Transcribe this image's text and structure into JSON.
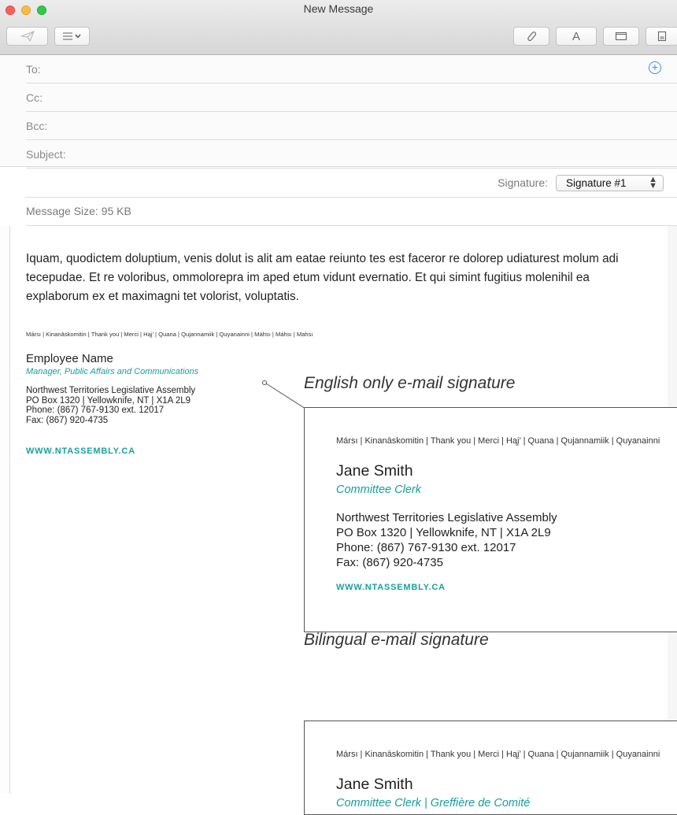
{
  "window": {
    "title": "New Message"
  },
  "toolbar": {
    "send_icon": "send-paper-plane-icon",
    "format_icon": "list-format-icon",
    "attach_icon": "paperclip-icon",
    "font_label": "A",
    "window_icon": "window-icon",
    "photo_browser_icon": "photo-browser-icon"
  },
  "fields": {
    "to_label": "To:",
    "cc_label": "Cc:",
    "bcc_label": "Bcc:",
    "subject_label": "Subject:",
    "signature_label": "Signature:",
    "signature_value": "Signature #1",
    "message_size": "Message Size: 95 KB"
  },
  "body": {
    "paragraph": "Iquam, quodictem doluptium, venis dolut is alit am eatae reiunto tes est faceror re dolorep udiaturest molum adi tecepudae. Et re voloribus, ommolorepra im aped etum vidunt evernatio. Et qui simint fugitius molenihil ea explaborum ex et maximagni tet volorist, voluptatis.",
    "thanks_line": "Mársı | Kinanāskomitin | Thank you | Merci | Hąį’ | Quana | Qujannamiik | Quyanainni | Máhsı | Máhsı | Mahsı",
    "signature": {
      "name": "Employee Name",
      "title": "Manager, Public Affairs and Communications",
      "org": "Northwest Territories Legislative Assembly",
      "address": "PO Box 1320  |  Yellowknife, NT  |  X1A 2L9",
      "phone": "Phone: (867) 767-9130 ext. 12017",
      "fax": "Fax: (867) 920-4735",
      "url": "WWW.NTASSEMBLY.CA"
    }
  },
  "examples": [
    {
      "caption": "English only e-mail signature",
      "thanks_line": "Mársı | Kinanāskomitin | Thank you | Merci | Hąį’ | Quana | Qujannamiik | Quyanainni",
      "name": "Jane Smith",
      "title": "Committee Clerk",
      "org": "Northwest Territories Legislative Assembly",
      "address": "PO Box 1320  |  Yellowknife, NT  |  X1A 2L9",
      "phone": "Phone: (867) 767-9130 ext. 12017",
      "fax": "Fax: (867) 920-4735",
      "url": "WWW.NTASSEMBLY.CA"
    },
    {
      "caption": "Bilingual e-mail signature",
      "thanks_line": "Mársı | Kinanāskomitin | Thank you | Merci | Hąį’ | Quana | Qujannamiik | Quyanainni",
      "name": "Jane Smith",
      "title": "Committee Clerk  |  Greffière de Comité"
    }
  ],
  "colors": {
    "accent_teal": "#1a9c9c",
    "link_blue": "#3b8fe8"
  }
}
